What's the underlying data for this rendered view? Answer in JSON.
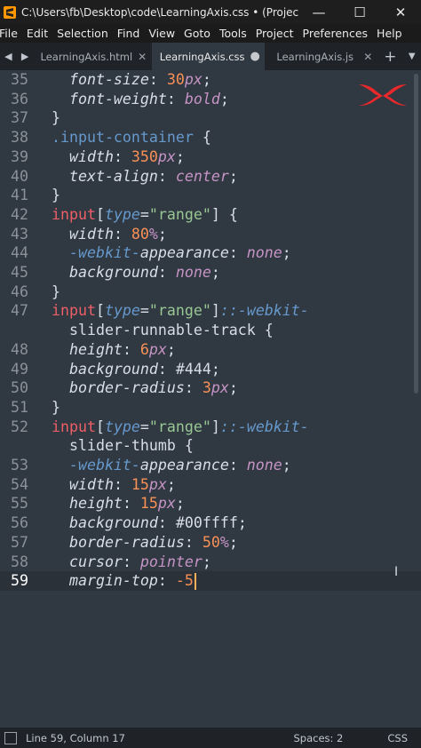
{
  "window": {
    "title": "C:\\Users\\fb\\Desktop\\code\\LearningAxis.css • (Project) - Subl...",
    "minimize": "—",
    "maximize": "☐",
    "close": "✕"
  },
  "menu": [
    "File",
    "Edit",
    "Selection",
    "Find",
    "View",
    "Goto",
    "Tools",
    "Project",
    "Preferences",
    "Help"
  ],
  "tabs": [
    {
      "label": "LearningAxis.html",
      "close": "✕"
    },
    {
      "label": "LearningAxis.css",
      "close": "●"
    },
    {
      "label": "LearningAxis.js",
      "close": "✕"
    }
  ],
  "tab_nav": {
    "prev": "◀",
    "next": "▶",
    "add": "+",
    "more": "▼"
  },
  "editor": {
    "current_line": "59",
    "lines": [
      {
        "n": "35",
        "tokens": [
          [
            "prop",
            "  font-size"
          ],
          [
            "punct",
            ": "
          ],
          [
            "num",
            "30"
          ],
          [
            "unit",
            "px"
          ],
          [
            "punct",
            ";"
          ]
        ]
      },
      {
        "n": "36",
        "tokens": [
          [
            "prop",
            "  font-weight"
          ],
          [
            "punct",
            ": "
          ],
          [
            "kw",
            "bold"
          ],
          [
            "punct",
            ";"
          ]
        ]
      },
      {
        "n": "37",
        "tokens": [
          [
            "punct",
            "}"
          ]
        ]
      },
      {
        "n": "38",
        "tokens": [
          [
            "sel",
            ".input-container"
          ],
          [
            "punct",
            " {"
          ]
        ]
      },
      {
        "n": "39",
        "tokens": [
          [
            "prop",
            "  width"
          ],
          [
            "punct",
            ": "
          ],
          [
            "num",
            "350"
          ],
          [
            "unit",
            "px"
          ],
          [
            "punct",
            ";"
          ]
        ]
      },
      {
        "n": "40",
        "tokens": [
          [
            "prop",
            "  text-align"
          ],
          [
            "punct",
            ": "
          ],
          [
            "kw",
            "center"
          ],
          [
            "punct",
            ";"
          ]
        ]
      },
      {
        "n": "41",
        "tokens": [
          [
            "punct",
            "}"
          ]
        ]
      },
      {
        "n": "42",
        "tokens": [
          [
            "tag",
            "input"
          ],
          [
            "punct",
            "["
          ],
          [
            "pseudo",
            "type"
          ],
          [
            "punct",
            "="
          ],
          [
            "str",
            "\"range\""
          ],
          [
            "punct",
            "] {"
          ]
        ]
      },
      {
        "n": "43",
        "tokens": [
          [
            "prop",
            "  width"
          ],
          [
            "punct",
            ": "
          ],
          [
            "num",
            "80"
          ],
          [
            "unit",
            "%"
          ],
          [
            "punct",
            ";"
          ]
        ]
      },
      {
        "n": "44",
        "tokens": [
          [
            "vendor",
            "  -webkit-"
          ],
          [
            "prop",
            "appearance"
          ],
          [
            "punct",
            ": "
          ],
          [
            "kw",
            "none"
          ],
          [
            "punct",
            ";"
          ]
        ]
      },
      {
        "n": "45",
        "tokens": [
          [
            "prop",
            "  background"
          ],
          [
            "punct",
            ": "
          ],
          [
            "kw",
            "none"
          ],
          [
            "punct",
            ";"
          ]
        ]
      },
      {
        "n": "46",
        "tokens": [
          [
            "punct",
            "}"
          ]
        ]
      },
      {
        "n": "47",
        "tokens": [
          [
            "tag",
            "input"
          ],
          [
            "punct",
            "["
          ],
          [
            "pseudo",
            "type"
          ],
          [
            "punct",
            "="
          ],
          [
            "str",
            "\"range\""
          ],
          [
            "punct",
            "]"
          ],
          [
            "pseudo",
            "::-webkit-"
          ]
        ]
      },
      {
        "n": "",
        "tokens": [
          [
            "punct",
            "  slider-runnable-track {"
          ]
        ]
      },
      {
        "n": "48",
        "tokens": [
          [
            "prop",
            "  height"
          ],
          [
            "punct",
            ": "
          ],
          [
            "num",
            "6"
          ],
          [
            "unit",
            "px"
          ],
          [
            "punct",
            ";"
          ]
        ]
      },
      {
        "n": "49",
        "tokens": [
          [
            "prop",
            "  background"
          ],
          [
            "punct",
            ": "
          ],
          [
            "hash",
            "#444"
          ],
          [
            "punct",
            ";"
          ]
        ]
      },
      {
        "n": "50",
        "tokens": [
          [
            "prop",
            "  border-radius"
          ],
          [
            "punct",
            ": "
          ],
          [
            "num",
            "3"
          ],
          [
            "unit",
            "px"
          ],
          [
            "punct",
            ";"
          ]
        ]
      },
      {
        "n": "51",
        "tokens": [
          [
            "punct",
            "}"
          ]
        ]
      },
      {
        "n": "52",
        "tokens": [
          [
            "tag",
            "input"
          ],
          [
            "punct",
            "["
          ],
          [
            "pseudo",
            "type"
          ],
          [
            "punct",
            "="
          ],
          [
            "str",
            "\"range\""
          ],
          [
            "punct",
            "]"
          ],
          [
            "pseudo",
            "::-webkit-"
          ]
        ]
      },
      {
        "n": "",
        "tokens": [
          [
            "punct",
            "  slider-thumb {"
          ]
        ]
      },
      {
        "n": "53",
        "tokens": [
          [
            "vendor",
            "  -webkit-"
          ],
          [
            "prop",
            "appearance"
          ],
          [
            "punct",
            ": "
          ],
          [
            "kw",
            "none"
          ],
          [
            "punct",
            ";"
          ]
        ]
      },
      {
        "n": "54",
        "tokens": [
          [
            "prop",
            "  width"
          ],
          [
            "punct",
            ": "
          ],
          [
            "num",
            "15"
          ],
          [
            "unit",
            "px"
          ],
          [
            "punct",
            ";"
          ]
        ]
      },
      {
        "n": "55",
        "tokens": [
          [
            "prop",
            "  height"
          ],
          [
            "punct",
            ": "
          ],
          [
            "num",
            "15"
          ],
          [
            "unit",
            "px"
          ],
          [
            "punct",
            ";"
          ]
        ]
      },
      {
        "n": "56",
        "tokens": [
          [
            "prop",
            "  background"
          ],
          [
            "punct",
            ": "
          ],
          [
            "hash",
            "#00ffff"
          ],
          [
            "punct",
            ";"
          ]
        ]
      },
      {
        "n": "57",
        "tokens": [
          [
            "prop",
            "  border-radius"
          ],
          [
            "punct",
            ": "
          ],
          [
            "num",
            "50"
          ],
          [
            "unit",
            "%"
          ],
          [
            "punct",
            ";"
          ]
        ]
      },
      {
        "n": "58",
        "tokens": [
          [
            "prop",
            "  cursor"
          ],
          [
            "punct",
            ": "
          ],
          [
            "kw",
            "pointer"
          ],
          [
            "punct",
            ";"
          ]
        ]
      },
      {
        "n": "59",
        "tokens": [
          [
            "prop",
            "  margin-top"
          ],
          [
            "punct",
            ": "
          ],
          [
            "num",
            "-5"
          ]
        ]
      }
    ]
  },
  "status": {
    "position": "Line 59, Column 17",
    "spaces": "Spaces: 2",
    "syntax": "CSS"
  },
  "colors": {
    "editor_bg": "#303841",
    "selector": "#6699cc",
    "tag": "#ec5f67",
    "number": "#f99157",
    "keyword": "#c594c5",
    "string": "#99c794",
    "caret": "#f9ae58",
    "logo": "#e8282b"
  }
}
